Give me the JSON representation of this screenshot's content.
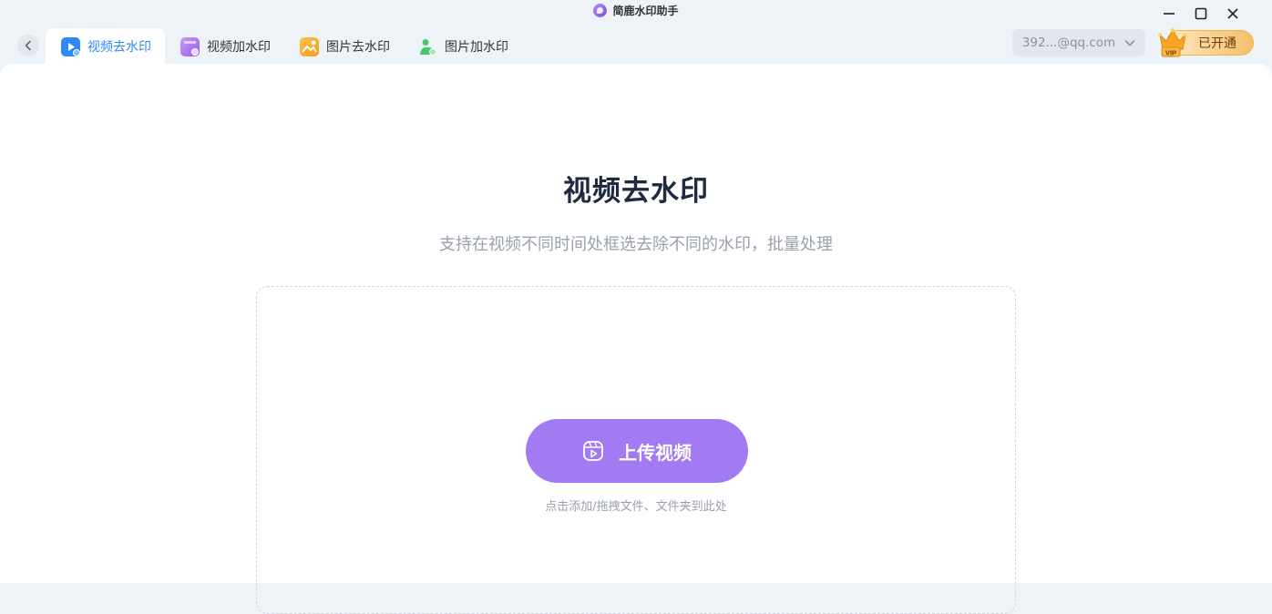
{
  "app": {
    "title": "简鹿水印助手",
    "logo_icon": "app-logo-icon"
  },
  "window_controls": [
    "minimize-icon",
    "maximize-icon",
    "close-icon"
  ],
  "nav": {
    "back_icon": "chevron-left-icon",
    "tabs": [
      {
        "label": "视频去水印",
        "icon": "video-remove-watermark-icon",
        "active": true,
        "color": "#2f8af5"
      },
      {
        "label": "视频加水印",
        "icon": "video-add-watermark-icon",
        "active": false,
        "color": "#a069e8"
      },
      {
        "label": "图片去水印",
        "icon": "image-remove-watermark-icon",
        "active": false,
        "color": "#f5a623"
      },
      {
        "label": "图片加水印",
        "icon": "image-add-watermark-icon",
        "active": false,
        "color": "#4cc46a"
      }
    ]
  },
  "account": {
    "label": "392...@qq.com",
    "icon": "chevron-down-icon"
  },
  "vip": {
    "label": "已开通",
    "badge_text": "VIP",
    "icon": "crown-icon"
  },
  "main": {
    "title": "视频去水印",
    "subtitle": "支持在视频不同时间处框选去除不同的水印，批量处理",
    "upload_button": {
      "label": "上传视频",
      "icon": "video-upload-icon",
      "color": "#a27af2"
    },
    "hint": "点击添加/拖拽文件、文件夹到此处"
  }
}
